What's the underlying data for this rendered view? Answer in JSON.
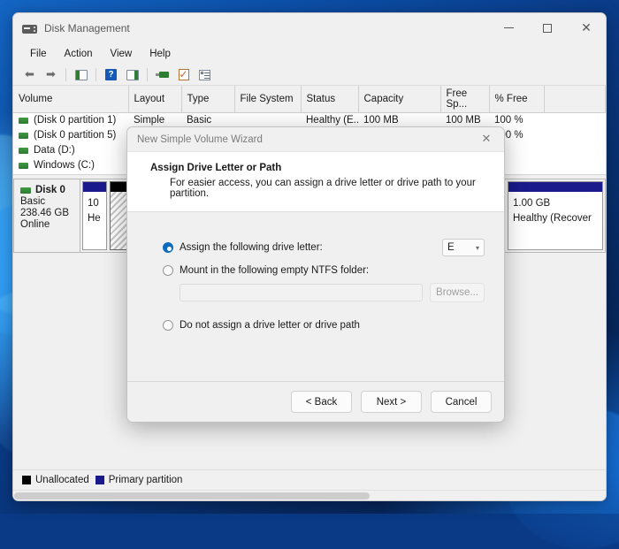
{
  "desktop": {
    "wallpaper": "windows11-bloom-blue"
  },
  "window": {
    "title": "Disk Management",
    "title_icon": "disk-drive-icon",
    "controls": {
      "minimize": "minimize-icon",
      "maximize": "maximize-icon",
      "close": "close-icon"
    },
    "menus": [
      "File",
      "Action",
      "View",
      "Help"
    ],
    "toolbar": [
      {
        "name": "back-icon",
        "glyph": "←"
      },
      {
        "name": "forward-icon",
        "glyph": "→"
      },
      {
        "name": "show-hide-console-tree-icon",
        "glyph": ""
      },
      {
        "name": "help-icon",
        "glyph": "?"
      },
      {
        "name": "show-action-pane-icon",
        "glyph": ""
      },
      {
        "name": "rescan-disks-icon",
        "glyph": ""
      },
      {
        "name": "properties-icon",
        "glyph": "✓"
      },
      {
        "name": "details-list-icon",
        "glyph": ""
      }
    ]
  },
  "volume_table": {
    "columns": [
      "Volume",
      "Layout",
      "Type",
      "File System",
      "Status",
      "Capacity",
      "Free Sp...",
      "% Free"
    ],
    "rows": [
      {
        "volume": "(Disk 0 partition 1)",
        "layout": "Simple",
        "type": "Basic",
        "file_system": "",
        "status": "Healthy (E...",
        "capacity": "100 MB",
        "free_space": "100 MB",
        "percent_free": "100 %"
      },
      {
        "volume": "(Disk 0 partition 5)",
        "layout": "",
        "type": "",
        "file_system": "",
        "status": "",
        "capacity": "",
        "free_space": "",
        "percent_free": "100 %"
      },
      {
        "volume": "Data (D:)",
        "layout": "",
        "type": "",
        "file_system": "",
        "status": "",
        "capacity": "",
        "free_space": "",
        "percent_free": ""
      },
      {
        "volume": "Windows (C:)",
        "layout": "",
        "type": "",
        "file_system": "",
        "status": "",
        "capacity": "",
        "free_space": "",
        "percent_free": ""
      }
    ]
  },
  "disk_view": {
    "disk": {
      "icon": "disk-drive-icon",
      "name": "Disk 0",
      "kind": "Basic",
      "size": "238.46 GB",
      "state": "Online"
    },
    "partitions": [
      {
        "type": "primary",
        "line1": "10",
        "line2": "He"
      },
      {
        "type": "unallocated",
        "line1": "",
        "line2": ""
      },
      {
        "type": "primary",
        "line1": "1.00 GB",
        "line2": "Healthy (Recover"
      }
    ]
  },
  "legend": [
    {
      "label": "Unallocated",
      "color": "#000000"
    },
    {
      "label": "Primary partition",
      "color": "#1a1a8c"
    }
  ],
  "wizard": {
    "title": "New Simple Volume Wizard",
    "close_icon": "close-icon",
    "heading": "Assign Drive Letter or Path",
    "subheading": "For easier access, you can assign a drive letter or drive path to your partition.",
    "options": [
      {
        "label": "Assign the following drive letter:",
        "selected": true
      },
      {
        "label": "Mount in the following empty NTFS folder:",
        "selected": false
      },
      {
        "label": "Do not assign a drive letter or drive path",
        "selected": false
      }
    ],
    "drive_letter": {
      "value": "E",
      "chevron": "chevron-down-icon"
    },
    "mount_path": {
      "value": "",
      "placeholder": ""
    },
    "browse_label": "Browse...",
    "buttons": {
      "back": "< Back",
      "next": "Next >",
      "cancel": "Cancel"
    },
    "accent_color": "#0f6cbd"
  }
}
